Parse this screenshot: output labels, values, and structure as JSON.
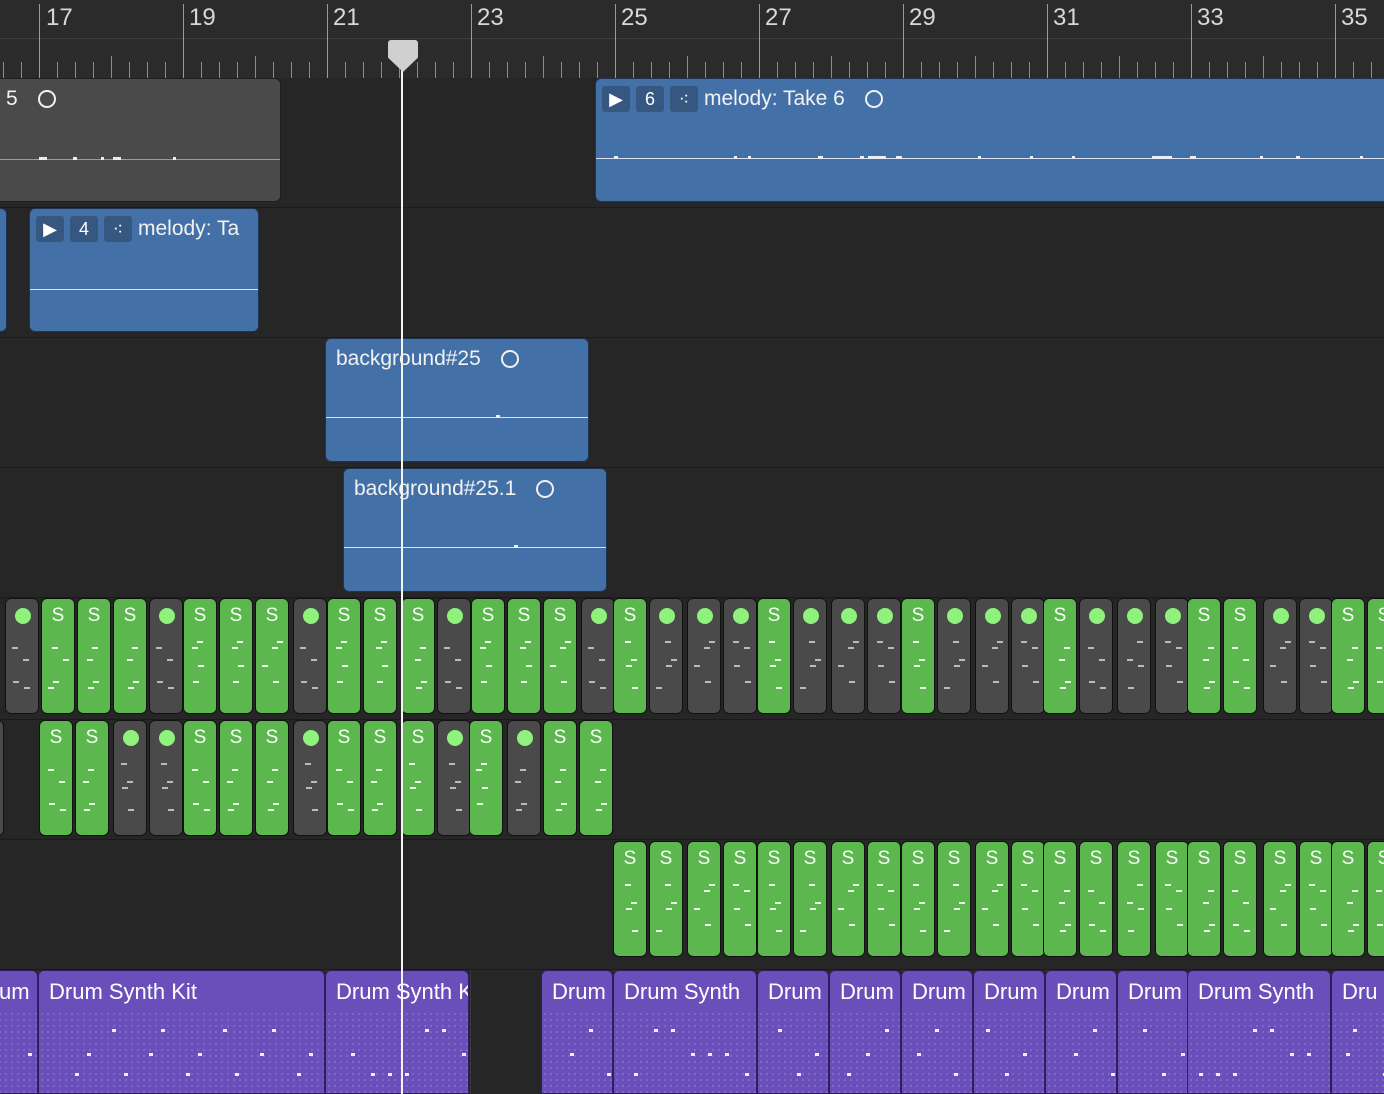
{
  "ruler": {
    "bars": [
      "17",
      "19",
      "21",
      "23",
      "25",
      "27",
      "29",
      "31",
      "33",
      "35"
    ]
  },
  "regions": {
    "take5": {
      "number": "5"
    },
    "take6": {
      "number": "6",
      "name": "melody: Take 6"
    },
    "take4": {
      "number": "4",
      "name": "melody: Ta"
    },
    "bg25": {
      "name": "background#25"
    },
    "bg251": {
      "name": "background#25.1"
    }
  },
  "pattern_cell_label": "S",
  "drum_regions": [
    "um",
    "Drum Synth Kit",
    "Drum Synth Kit",
    "Drum",
    "Drum Synth",
    "Drum",
    "Drum",
    "Drum",
    "Drum",
    "Drum",
    "Drum",
    "Drum Synth",
    "Dru"
  ],
  "colors": {
    "audio_region": "#4470a8",
    "pattern_green": "#5cb74f",
    "drum_region": "#6a4fbb"
  },
  "icons": [
    "play-icon",
    "take-folder-icon",
    "loop-circle-icon",
    "playhead-icon"
  ]
}
